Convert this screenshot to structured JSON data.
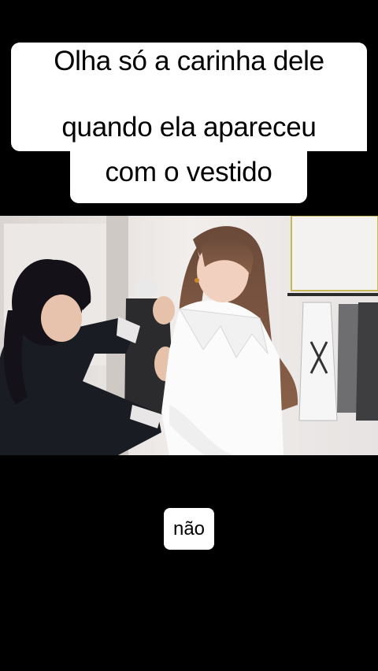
{
  "overlay": {
    "caption_line1": "Olha só a carinha dele",
    "caption_line2": "quando ela apareceu",
    "caption_line3": "com o vestido"
  },
  "video": {
    "subtitle": "não"
  },
  "colors": {
    "background": "#000000",
    "caption_bg": "#ffffff",
    "caption_text": "#000000"
  }
}
